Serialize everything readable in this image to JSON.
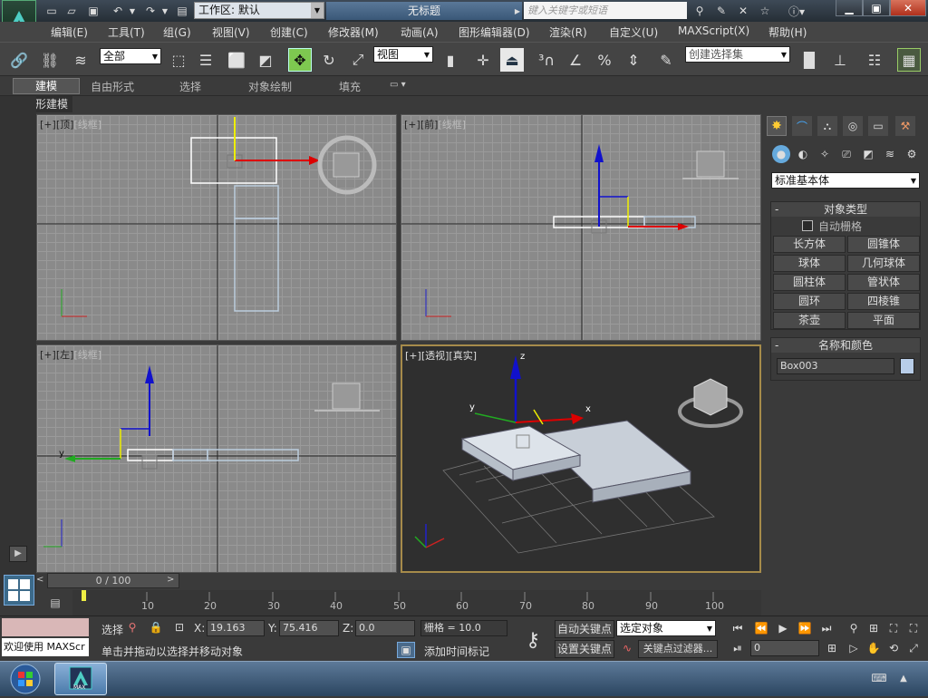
{
  "titlebar": {
    "workspace_label": "工作区: 默认",
    "doc_title": "无标题",
    "search_placeholder": "键入关键字或短语"
  },
  "menu": [
    "编辑(E)",
    "工具(T)",
    "组(G)",
    "视图(V)",
    "创建(C)",
    "修改器(M)",
    "动画(A)",
    "图形编辑器(D)",
    "渲染(R)",
    "自定义(U)",
    "MAXScript(X)",
    "帮助(H)"
  ],
  "toolbar": {
    "filter_value": "全部",
    "refcoord_value": "视图",
    "selset_value": "创建选择集"
  },
  "ribbon_tabs": [
    "建模",
    "自由形式",
    "选择",
    "对象绘制",
    "填充"
  ],
  "polygon_modeling": "多边形建模",
  "viewports": {
    "top": {
      "l1": "[+]",
      "l2": "[顶]",
      "l3": "[线框]"
    },
    "front": {
      "l1": "[+]",
      "l2": "[前]",
      "l3": "[线框]"
    },
    "left": {
      "l1": "[+]",
      "l2": "[左]",
      "l3": "[线框]"
    },
    "persp": {
      "l1": "[+]",
      "l2": "[透视]",
      "l3": "[真实]"
    }
  },
  "command_panel": {
    "category": "标准基本体",
    "object_type_title": "对象类型",
    "autogrid": "自动栅格",
    "objects": [
      "长方体",
      "圆锥体",
      "球体",
      "几何球体",
      "圆柱体",
      "管状体",
      "圆环",
      "四棱锥",
      "茶壶",
      "平面"
    ],
    "name_color_title": "名称和颜色",
    "object_name": "Box003",
    "object_color": "#b8cde8"
  },
  "timeline": {
    "slider": "0 / 100",
    "ticks": [
      "10",
      "20",
      "30",
      "40",
      "50",
      "60",
      "70",
      "80",
      "90",
      "100"
    ]
  },
  "status": {
    "welcome": "欢迎使用 MAXScr",
    "select_label": "选择",
    "x_label": "X:",
    "x_value": "19.163",
    "y_label": "Y:",
    "y_value": "75.416",
    "z_label": "Z:",
    "z_value": "0.0",
    "grid": "栅格 = 10.0",
    "prompt": "单击并拖动以选择并移动对象",
    "add_time_tag": "添加时间标记",
    "auto_key": "自动关键点",
    "set_key": "设置关键点",
    "key_filter_value": "选定对象",
    "key_filters": "关键点过滤器...",
    "frame_value": "0"
  },
  "axis": {
    "x": "x",
    "y": "y",
    "z": "z"
  },
  "taskbar": {
    "app_label": "MAX"
  }
}
